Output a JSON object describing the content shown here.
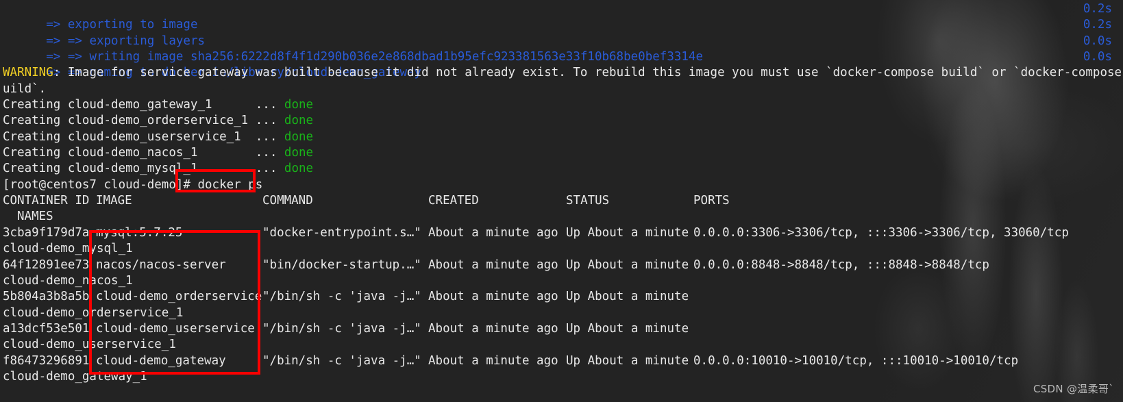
{
  "terminal": {
    "background_color": "#232323",
    "foreground_color": "#e8e8e8",
    "blue_color": "#2a5bd7",
    "green_color": "#19b319",
    "yellow_color": "#f2d024",
    "annotation_color": "#fb0000"
  },
  "buildkit": {
    "steps": [
      {
        "prefix": "=>",
        "text": " exporting to image",
        "time": "0.2s"
      },
      {
        "prefix": "=> =>",
        "text": " exporting layers",
        "time": "0.2s"
      },
      {
        "prefix": "=> =>",
        "text": " writing image sha256:6222d8f4f1d290b036e2e868dbad1b95efc923381563e33f10b68be0bef3314e",
        "time": "0.0s"
      },
      {
        "prefix": "=> =>",
        "text": " naming to docker.io/library/cloud-demo_gateway",
        "time": "0.0s"
      }
    ]
  },
  "warning": {
    "label": "WARNING",
    "line1": ": Image for service gateway was built because it did not already exist. To rebuild this image you must use `docker-compose build` or `docker-compose up --b",
    "line2": "uild`."
  },
  "creating": [
    {
      "text": "Creating cloud-demo_gateway_1      ... ",
      "status": "done"
    },
    {
      "text": "Creating cloud-demo_orderservice_1 ... ",
      "status": "done"
    },
    {
      "text": "Creating cloud-demo_userservice_1  ... ",
      "status": "done"
    },
    {
      "text": "Creating cloud-demo_nacos_1        ... ",
      "status": "done"
    },
    {
      "text": "Creating cloud-demo_mysql_1        ... ",
      "status": "done"
    }
  ],
  "prompt": {
    "text": "[root@centos7 cloud-demo]# ",
    "command": "docker ps"
  },
  "docker_ps": {
    "headers": {
      "container_id": "CONTAINER ID",
      "image": "IMAGE",
      "command": "COMMAND",
      "created": "CREATED",
      "status": "STATUS",
      "ports": "PORTS",
      "names": "NAMES"
    },
    "rows": [
      {
        "container_id": "3cba9f179d7a",
        "image": "mysql:5.7.25",
        "command": "\"docker-entrypoint.s…\"",
        "created": "About a minute ago",
        "status": "Up About a minute",
        "ports": "0.0.0.0:3306->3306/tcp, :::3306->3306/tcp, 33060/tcp",
        "names": "cloud-demo_mysql_1"
      },
      {
        "container_id": "64f12891ee73",
        "image": "nacos/nacos-server",
        "command": "\"bin/docker-startup.…\"",
        "created": "About a minute ago",
        "status": "Up About a minute",
        "ports": "0.0.0.0:8848->8848/tcp, :::8848->8848/tcp",
        "names": "cloud-demo_nacos_1"
      },
      {
        "container_id": "5b804a3b8a5b",
        "image": "cloud-demo_orderservice",
        "command": "\"/bin/sh -c 'java -j…\"",
        "created": "About a minute ago",
        "status": "Up About a minute",
        "ports": "",
        "names": "cloud-demo_orderservice_1"
      },
      {
        "container_id": "a13dcf53e501",
        "image": "cloud-demo_userservice",
        "command": "\"/bin/sh -c 'java -j…\"",
        "created": "About a minute ago",
        "status": "Up About a minute",
        "ports": "",
        "names": "cloud-demo_userservice_1"
      },
      {
        "container_id": "f86473296891",
        "image": "cloud-demo_gateway",
        "command": "\"/bin/sh -c 'java -j…\"",
        "created": "About a minute ago",
        "status": "Up About a minute",
        "ports": "0.0.0.0:10010->10010/tcp, :::10010->10010/tcp",
        "names": "cloud-demo_gateway_1"
      }
    ]
  },
  "watermark": {
    "text": "CSDN @温柔哥`"
  }
}
